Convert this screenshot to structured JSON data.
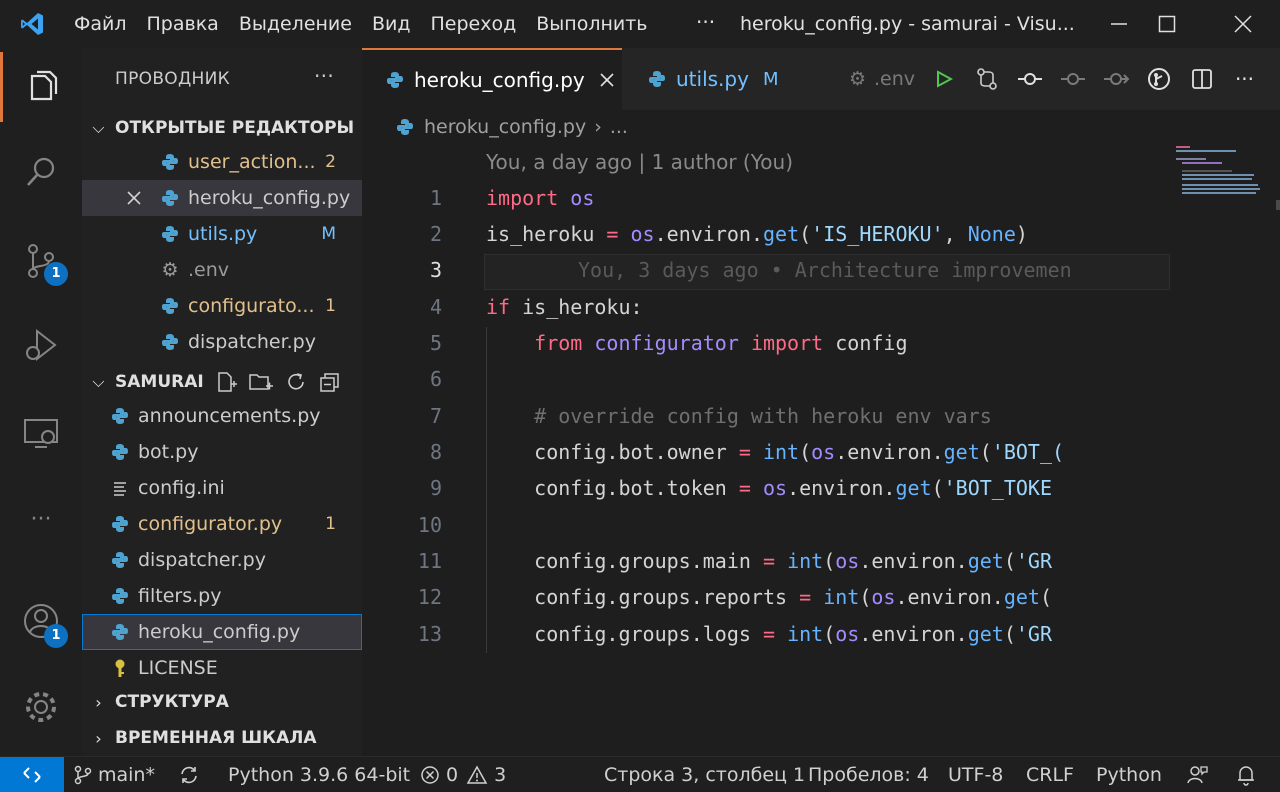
{
  "window": {
    "menu": [
      "Файл",
      "Правка",
      "Выделение",
      "Вид",
      "Переход",
      "Выполнить"
    ],
    "more": "···",
    "title": "heroku_config.py - samurai - Visu..."
  },
  "activity": {
    "scm_badge": "1",
    "accounts_badge": "1",
    "more": "···"
  },
  "sidebar": {
    "header": "ПРОВОДНИК",
    "header_more": "···",
    "open_editors": {
      "title": "ОТКРЫТЫЕ РЕДАКТОРЫ",
      "items": [
        {
          "name": "user_action...",
          "tag": "2",
          "color": "#e2c08d"
        },
        {
          "name": "heroku_config.py",
          "tag": "",
          "color": "#cccccc"
        },
        {
          "name": "utils.py",
          "tag": "M",
          "color": "#73c0ff"
        },
        {
          "name": ".env",
          "tag": "",
          "color": "#9a9a9a"
        },
        {
          "name": "configurato...",
          "tag": "1",
          "color": "#e2c08d"
        },
        {
          "name": "dispatcher.py",
          "tag": "",
          "color": "#cccccc"
        }
      ]
    },
    "project": {
      "title": "SAMURAI",
      "files": [
        {
          "name": "announcements.py",
          "tag": ""
        },
        {
          "name": "bot.py",
          "tag": ""
        },
        {
          "name": "config.ini",
          "tag": ""
        },
        {
          "name": "configurator.py",
          "tag": "1"
        },
        {
          "name": "dispatcher.py",
          "tag": ""
        },
        {
          "name": "filters.py",
          "tag": ""
        },
        {
          "name": "heroku_config.py",
          "tag": ""
        },
        {
          "name": "LICENSE",
          "tag": ""
        }
      ]
    },
    "outline_title": "СТРУКТУРА",
    "timeline_title": "ВРЕМЕННАЯ ШКАЛА"
  },
  "tabs": [
    {
      "label": "heroku_config.py",
      "active": true
    },
    {
      "label": "utils.py",
      "status": "M"
    }
  ],
  "tab_actions": {
    "env_label": ".env"
  },
  "breadcrumb": {
    "file": "heroku_config.py",
    "rest": "..."
  },
  "editor": {
    "blame_header": "You, a day ago | 1 author (You)",
    "inline_blame": "You, 3 days ago • Architecture improvemen",
    "line_numbers": [
      "1",
      "2",
      "3",
      "4",
      "5",
      "6",
      "7",
      "8",
      "9",
      "10",
      "11",
      "12",
      "13"
    ],
    "current_line": "3",
    "lines": {
      "l1": {
        "kw": "import",
        "mod": "os"
      },
      "l2": {
        "a": "is_heroku",
        "op": "=",
        "b": "os",
        "c": ".environ.",
        "d": "get",
        "e": "(",
        "f": "'IS_HEROKU'",
        "g": ", ",
        "h": "None",
        "i": ")"
      },
      "l4": {
        "kw": "if",
        "a": "is_heroku:"
      },
      "l5": {
        "kw": "from",
        "mod": "configurator",
        "kw2": "import",
        "a": "config"
      },
      "l7": {
        "cm": "# override config with heroku env vars"
      },
      "l8": {
        "a": "config.bot.owner",
        "op": "=",
        "fn": "int",
        "b": "(",
        "c": "os",
        "d": ".environ.",
        "e": "get",
        "f": "(",
        "s": "'BOT_("
      },
      "l9": {
        "a": "config.bot.token",
        "op": "=",
        "b": "os",
        "c": ".environ.",
        "d": "get",
        "e": "(",
        "s": "'BOT_TOKE"
      },
      "l11": {
        "a": "config.groups.main",
        "op": "=",
        "fn": "int",
        "b": "(",
        "c": "os",
        "d": ".environ.",
        "e": "get",
        "f": "(",
        "s": "'GR"
      },
      "l12": {
        "a": "config.groups.reports",
        "op": "=",
        "fn": "int",
        "b": "(",
        "c": "os",
        "d": ".environ.",
        "e": "get",
        "f": "("
      },
      "l13": {
        "a": "config.groups.logs",
        "op": "=",
        "fn": "int",
        "b": "(",
        "c": "os",
        "d": ".environ.",
        "e": "get",
        "f": "(",
        "s": "'GR"
      }
    }
  },
  "statusbar": {
    "branch": "main*",
    "interpreter": "Python 3.9.6 64-bit",
    "errors": "0",
    "warnings": "3",
    "position": "Строка 3, столбец 1",
    "spaces": "Пробелов: 4",
    "encoding": "UTF-8",
    "eol": "CRLF",
    "language": "Python"
  },
  "colors": {
    "accent": "#0078d4",
    "active_tab_border": "#e0783c",
    "badge": "#0e70c0"
  }
}
